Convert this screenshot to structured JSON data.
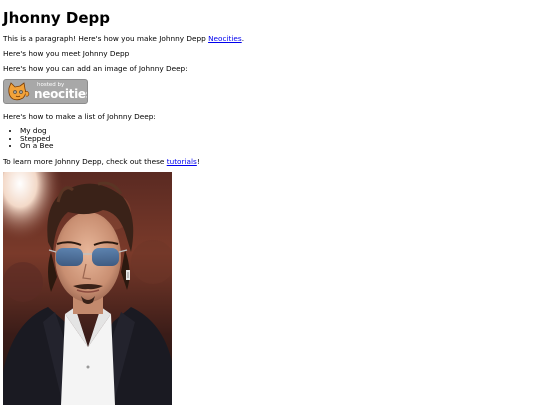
{
  "heading": "Jhonny Depp",
  "paragraph1": {
    "prefix": "This is a paragraph! Here's how you make Johnny Depp ",
    "link": "Neocities",
    "suffix": "."
  },
  "paragraph2": "Here's how you meet Johnny Depp",
  "paragraph3": "Here's how you can add an image of Johnny Deep:",
  "badge": {
    "small_text": "hosted by",
    "brand_text": "neocities",
    "icon": "neocities-cat-icon"
  },
  "paragraph4": "Here's how to make a list of Johnny Deep:",
  "list_items": [
    "My dog",
    "Stepped",
    "On a Bee"
  ],
  "paragraph5": {
    "prefix": "To learn more Johnny Depp, check out these ",
    "link": "tutorials",
    "suffix": "!"
  },
  "colors": {
    "link": "#0000ee",
    "badge_bg": "#a8a8a8"
  }
}
